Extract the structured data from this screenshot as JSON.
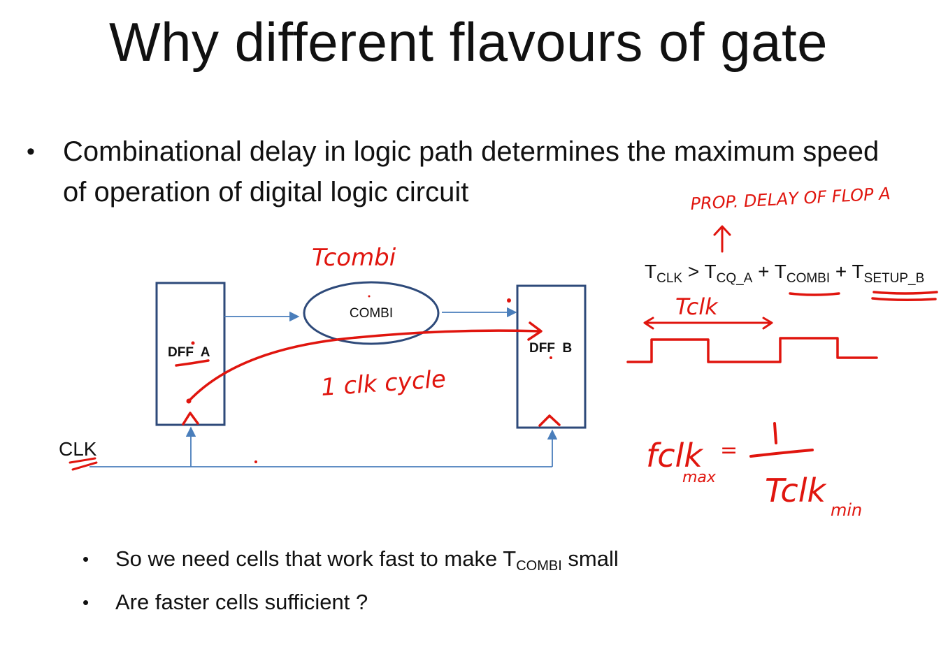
{
  "title": "Why different flavours of gate",
  "bullets": {
    "main": "Combinational delay in logic path determines the maximum speed of operation of digital logic circuit",
    "sub": [
      {
        "prefix": "So we need cells that work fast to make T",
        "subscript": "COMBI",
        "suffix": " small"
      },
      {
        "text": "Are faster cells sufficient ?"
      }
    ]
  },
  "diagram": {
    "dff_a_label": "DFF  A",
    "dff_b_label": "DFF  B",
    "combi_label": "COMBI",
    "clk_label": "CLK"
  },
  "equation": {
    "t1": "T",
    "s1": "CLK",
    "op1": " > ",
    "t2": "T",
    "s2": "CQ_A",
    "op2": " + ",
    "t3": "T",
    "s3": "COMBI",
    "op3": " + ",
    "t4": "T",
    "s4": "SETUP_B"
  },
  "annotations": {
    "prop_delay": "PROP. DELAY OF FLOP A",
    "tcombi": "Tcombi",
    "one_clk_cycle": "1 clk cycle",
    "tclk": "Tclk",
    "fclk": "fclk",
    "max": "max",
    "equals": "=",
    "one": "1",
    "tclk_min": "Tclk",
    "min": "min"
  },
  "colors": {
    "ink": "#e0150e",
    "box_stroke": "#2e4a7a",
    "wire": "#4a7ebb"
  }
}
